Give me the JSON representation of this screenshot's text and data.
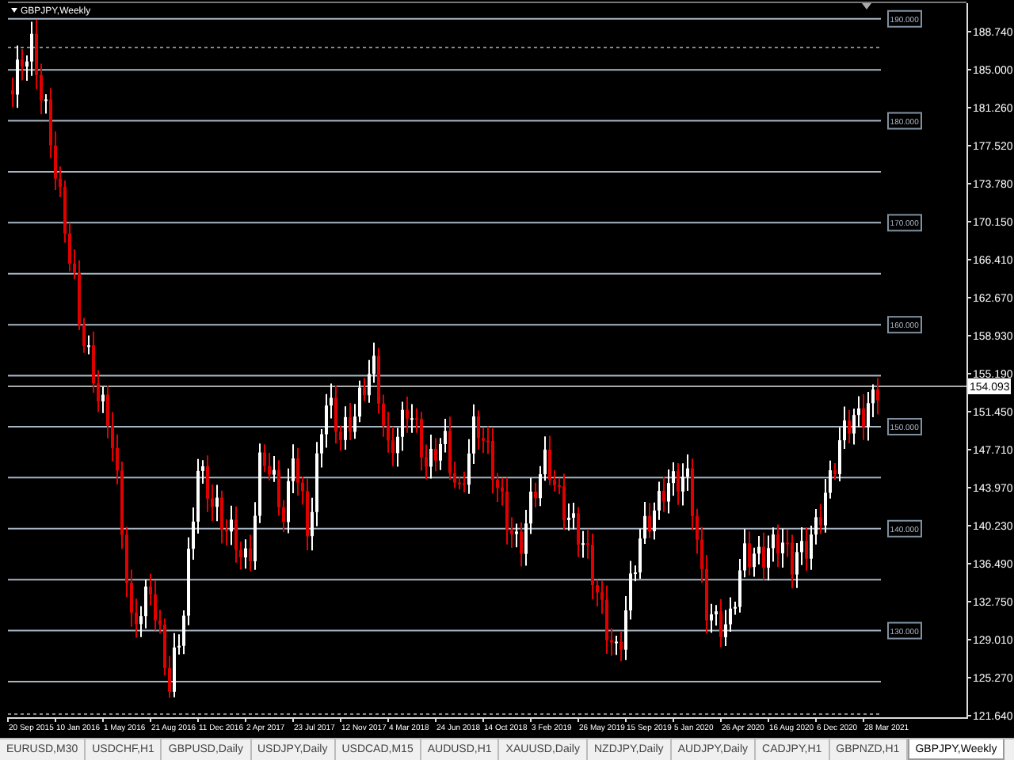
{
  "chart": {
    "title": "GBPJPY,Weekly",
    "price_ticks": [
      "188.740",
      "185.000",
      "181.260",
      "177.520",
      "173.780",
      "170.150",
      "166.410",
      "162.670",
      "158.930",
      "155.190",
      "151.450",
      "147.710",
      "143.970",
      "140.230",
      "136.490",
      "132.750",
      "129.010",
      "125.270",
      "121.640"
    ],
    "level_labels": [
      "190.000",
      "180.000",
      "170.000",
      "160.000",
      "150.000",
      "140.000",
      "130.000"
    ],
    "current_price": "154.093",
    "date_ticks": [
      "20 Sep 2015",
      "10 Jan 2016",
      "1 May 2016",
      "21 Aug 2016",
      "11 Dec 2016",
      "2 Apr 2017",
      "23 Jul 2017",
      "12 Nov 2017",
      "4 Mar 2018",
      "24 Jun 2018",
      "14 Oct 2018",
      "3 Feb 2019",
      "26 May 2019",
      "15 Sep 2019",
      "5 Jan 2020",
      "26 Apr 2020",
      "16 Aug 2020",
      "6 Dec 2020",
      "28 Mar 2021"
    ]
  },
  "tabs": [
    {
      "label": "EURUSD,M30",
      "selected": false
    },
    {
      "label": "USDCHF,H1",
      "selected": false
    },
    {
      "label": "GBPUSD,Daily",
      "selected": false
    },
    {
      "label": "USDJPY,Daily",
      "selected": false
    },
    {
      "label": "USDCAD,M15",
      "selected": false
    },
    {
      "label": "AUDUSD,H1",
      "selected": false
    },
    {
      "label": "XAUUSD,Daily",
      "selected": false
    },
    {
      "label": "NZDJPY,Daily",
      "selected": false
    },
    {
      "label": "AUDJPY,Daily",
      "selected": false
    },
    {
      "label": "CADJPY,H1",
      "selected": false
    },
    {
      "label": "GBPNZD,H1",
      "selected": false
    },
    {
      "label": "GBPJPY,Weekly",
      "selected": true
    }
  ]
}
